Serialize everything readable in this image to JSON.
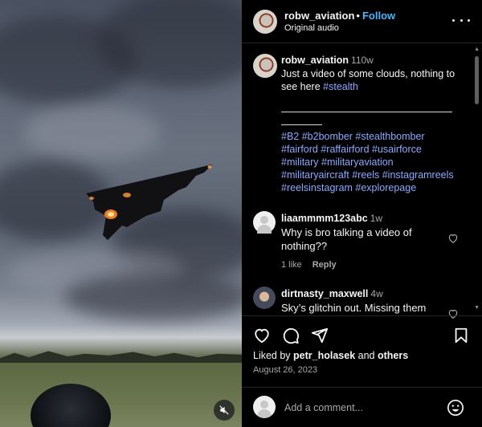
{
  "post": {
    "username": "robw_aviation",
    "separator": "•",
    "follow_label": "Follow",
    "audio": "Original audio",
    "more_icon": "more-horizontal-icon"
  },
  "caption": {
    "username": "robw_aviation",
    "time": "110w",
    "text": "Just a video of some clouds, nothing to see here",
    "hashtag": "#stealth",
    "tags_line1": "#B2 #b2bomber #stealthbomber",
    "tags_line2": "#fairford #raffairford #usairforce",
    "tags_line3": "#military #militaryaviation",
    "tags_line4": "#militaryaircraft #reels #instagramreels",
    "tags_line5": "#reelsinstagram #explorepage"
  },
  "comments": [
    {
      "username": "liaammmm123abc",
      "time": "1w",
      "line1": "Why is bro talking a video of",
      "line2": "nothing??",
      "likes": "1 like",
      "reply_label": "Reply"
    },
    {
      "username": "dirtnasty_maxwell",
      "time": "4w",
      "line1": "Sky’s glitchin out. Missing them"
    }
  ],
  "actions": {
    "like_icon": "heart-icon",
    "comment_icon": "comment-icon",
    "share_icon": "share-icon",
    "save_icon": "bookmark-icon"
  },
  "likes": {
    "prefix": "Liked by",
    "user": "petr_holasek",
    "conjunction": "and",
    "others": "others"
  },
  "date": "August 26, 2023",
  "composer": {
    "placeholder": "Add a comment...",
    "emoji_icon": "emoji-icon"
  },
  "video": {
    "mute_icon": "muted-speaker-icon"
  },
  "colors": {
    "accent": "#4cb5f9",
    "hashtag": "#8fa8ff",
    "background": "#000000",
    "muted_text": "#a8a8a8"
  }
}
